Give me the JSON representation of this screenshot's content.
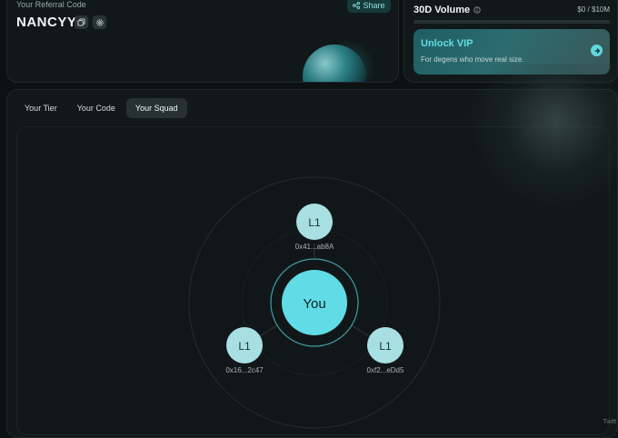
{
  "referral": {
    "label": "Your Referral Code",
    "code": "NANCYY",
    "share_label": "Share"
  },
  "volume": {
    "label": "30D Volume",
    "value": "$0 / $10M",
    "progress_fraction": 0
  },
  "vip": {
    "title": "Unlock VIP",
    "subtitle": "For degens who move real size."
  },
  "tabs": [
    {
      "label": "Your Tier",
      "active": false
    },
    {
      "label": "Your Code",
      "active": false
    },
    {
      "label": "Your Squad",
      "active": true
    }
  ],
  "squad": {
    "center_label": "You",
    "nodes": [
      {
        "level": "L1",
        "address": "0x41...ab8A"
      },
      {
        "level": "L1",
        "address": "0x16...2c47"
      },
      {
        "level": "L1",
        "address": "0xf2...eDd5"
      }
    ]
  },
  "footer": {
    "text": "Twitt"
  },
  "colors": {
    "accent": "#5fd8df",
    "node_fill": "#a8dfe2",
    "background": "#0c1112"
  }
}
